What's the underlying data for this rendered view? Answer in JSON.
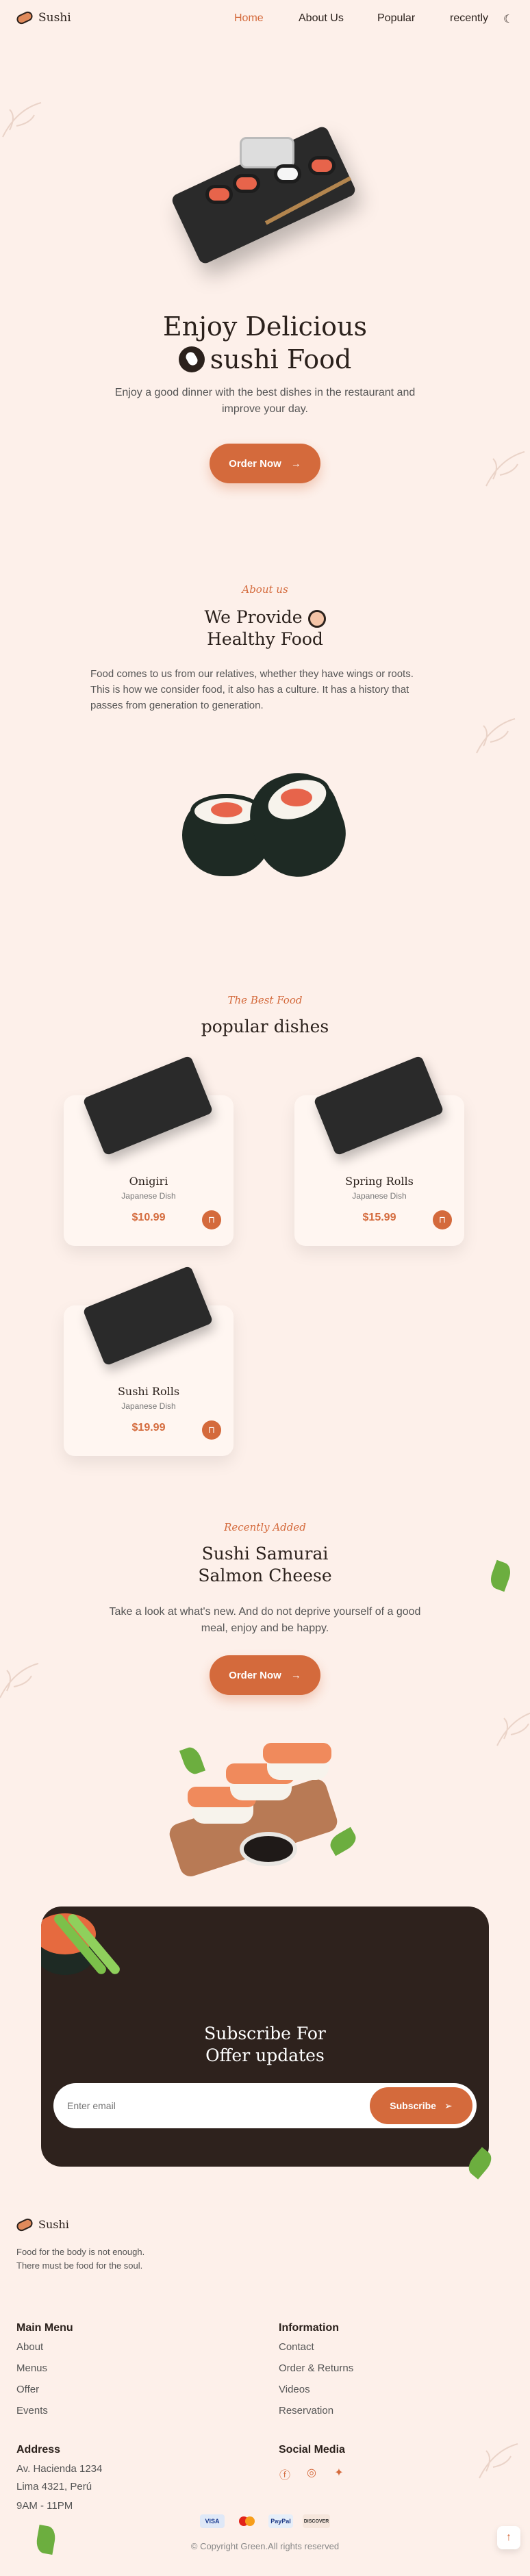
{
  "header": {
    "brand": "Sushi",
    "nav": [
      "Home",
      "About Us",
      "Popular",
      "recently"
    ],
    "active_nav": "Home",
    "theme_icon": "moon-icon"
  },
  "hero": {
    "title_line1": "Enjoy Delicious",
    "title_line2": "sushi Food",
    "description": "Enjoy a good dinner with the best dishes in the restaurant and improve your day.",
    "button": "Order Now"
  },
  "about": {
    "subtitle": "About us",
    "title_line1": "We Provide",
    "title_line2": "Healthy Food",
    "text": "Food comes to us from our relatives, whether they have wings or roots. This is how we consider food, it also has a culture. It has a history that passes from generation to generation."
  },
  "popular": {
    "subtitle": "The Best Food",
    "title": "popular dishes",
    "dishes": [
      {
        "name": "Onigiri",
        "kind": "Japanese Dish",
        "price": "$10.99"
      },
      {
        "name": "Spring Rolls",
        "kind": "Japanese Dish",
        "price": "$15.99"
      },
      {
        "name": "Sushi Rolls",
        "kind": "Japanese Dish",
        "price": "$19.99"
      }
    ]
  },
  "recently": {
    "subtitle": "Recently Added",
    "title_line1": "Sushi Samurai",
    "title_line2": "Salmon Cheese",
    "text": "Take a look at what's new. And do not deprive yourself of a good meal, enjoy and be happy.",
    "button": "Order Now"
  },
  "subscribe": {
    "title_line1": "Subscribe For",
    "title_line2": "Offer updates",
    "placeholder": "Enter email",
    "button": "Subscribe"
  },
  "footer": {
    "brand": "Sushi",
    "description": "Food for the body is not enough. There must be food for the soul.",
    "main_menu": {
      "title": "Main Menu",
      "items": [
        "About",
        "Menus",
        "Offer",
        "Events"
      ]
    },
    "information": {
      "title": "Information",
      "items": [
        "Contact",
        "Order & Returns",
        "Videos",
        "Reservation"
      ]
    },
    "address": {
      "title": "Address",
      "lines": [
        "Av. Hacienda 1234",
        "Lima 4321, Perú",
        "9AM - 11PM"
      ]
    },
    "social": {
      "title": "Social Media",
      "icons": [
        "facebook-icon",
        "instagram-icon",
        "twitter-icon"
      ]
    },
    "payments": [
      "VISA",
      "Mastercard",
      "PayPal",
      "DISCOVER"
    ],
    "copyright": "© Copyright Green.All rights reserved"
  },
  "colors": {
    "accent": "#d46a3c",
    "background": "#fdf0ea",
    "dark": "#2e221d"
  }
}
